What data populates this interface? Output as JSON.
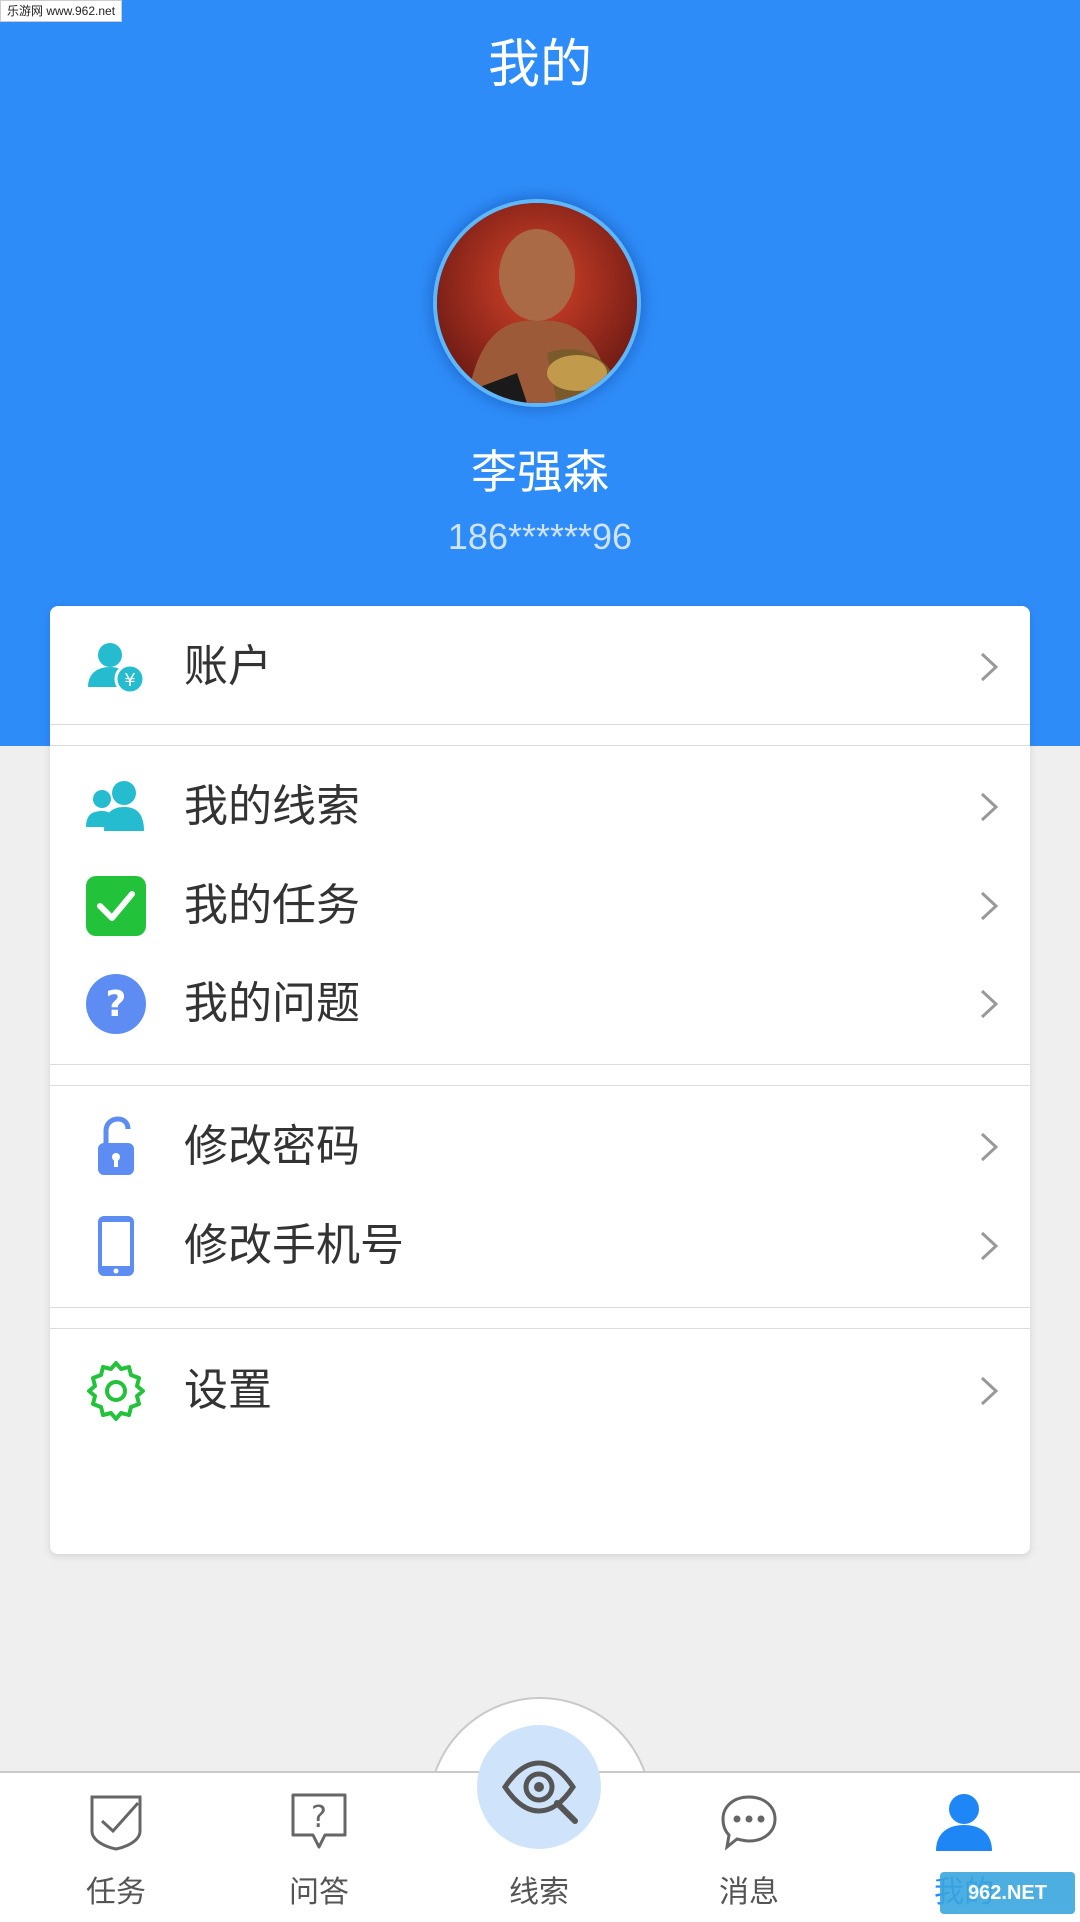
{
  "watermark": "乐游网 www.962.net",
  "header": {
    "title": "我的"
  },
  "profile": {
    "name": "李强森",
    "phone": "186******96"
  },
  "menu": {
    "account": {
      "label": "账户",
      "icon": "account-yen-icon"
    },
    "group1": [
      {
        "label": "我的线索",
        "icon": "people-icon"
      },
      {
        "label": "我的任务",
        "icon": "check-box-icon"
      },
      {
        "label": "我的问题",
        "icon": "question-circle-icon"
      }
    ],
    "group2": [
      {
        "label": "修改密码",
        "icon": "unlock-icon"
      },
      {
        "label": "修改手机号",
        "icon": "phone-icon"
      }
    ],
    "settings": {
      "label": "设置",
      "icon": "gear-icon"
    }
  },
  "tabbar": {
    "tabs": [
      {
        "label": "任务",
        "icon": "task-check-icon"
      },
      {
        "label": "问答",
        "icon": "question-bubble-icon"
      },
      {
        "label": "线索",
        "icon": "eye-search-icon"
      },
      {
        "label": "消息",
        "icon": "chat-bubble-icon"
      },
      {
        "label": "我的",
        "icon": "user-icon"
      }
    ]
  },
  "corner_logo": "962.NET",
  "colors": {
    "header_blue": "#2e8cf8",
    "teal_icon": "#26bcd0",
    "green_icon": "#22c23a",
    "indigo_icon": "#5d8df2",
    "active_tab": "#1f87f5"
  }
}
